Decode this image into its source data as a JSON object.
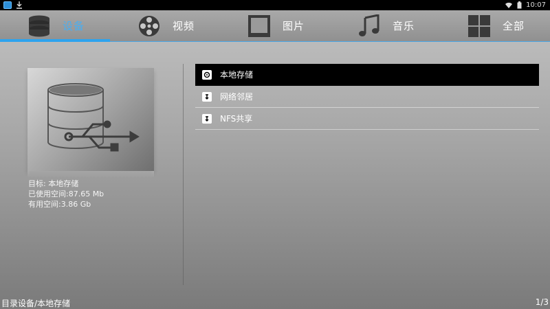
{
  "status_bar": {
    "time": "10:07",
    "icons": [
      "app-icon",
      "download-icon",
      "wifi-icon",
      "battery-icon"
    ]
  },
  "tabs": [
    {
      "label": "设备",
      "icon": "database-icon",
      "active": true
    },
    {
      "label": "视频",
      "icon": "film-reel-icon",
      "active": false
    },
    {
      "label": "图片",
      "icon": "picture-frame-icon",
      "active": false
    },
    {
      "label": "音乐",
      "icon": "music-note-icon",
      "active": false
    },
    {
      "label": "全部",
      "icon": "grid-icon",
      "active": false
    }
  ],
  "preview": {
    "icon": "usb-storage-icon",
    "target": "目标: 本地存储",
    "used_space": "已使用空间:87.65 Mb",
    "free_space": "有用空间:3.86 Gb"
  },
  "list": {
    "items": [
      {
        "label": "本地存储",
        "icon": "local-disk-icon",
        "selected": true
      },
      {
        "label": "网络邻居",
        "icon": "network-share-icon",
        "selected": false
      },
      {
        "label": "NFS共享",
        "icon": "network-share-icon",
        "selected": false
      }
    ]
  },
  "footer": {
    "path": "目录设备/本地存储",
    "page": "1/3"
  },
  "colors": {
    "accent": "#2ea3ee",
    "selected_bg": "#000000"
  }
}
